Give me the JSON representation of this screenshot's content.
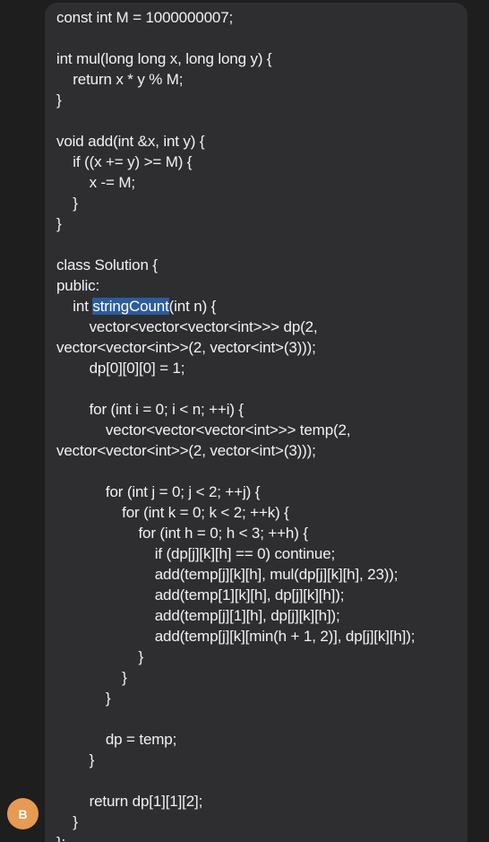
{
  "avatar": {
    "initial": "B",
    "color": "#e69a52"
  },
  "message": {
    "highlighted_word": "stringCount",
    "lines": [
      "const int M = 1000000007;",
      "",
      "int mul(long long x, long long y) {",
      "    return x * y % M;",
      "}",
      "",
      "void add(int &x, int y) {",
      "    if ((x += y) >= M) {",
      "        x -= M;",
      "    }",
      "}",
      "",
      "class Solution {",
      "public:",
      "    int ",
      "        vector<vector<vector<int>>> dp(2,",
      "vector<vector<int>>(2, vector<int>(3)));",
      "        dp[0][0][0] = 1;",
      "",
      "        for (int i = 0; i < n; ++i) {",
      "            vector<vector<vector<int>>> temp(2,",
      "vector<vector<int>>(2, vector<int>(3)));",
      "",
      "            for (int j = 0; j < 2; ++j) {",
      "                for (int k = 0; k < 2; ++k) {",
      "                    for (int h = 0; h < 3; ++h) {",
      "                        if (dp[j][k][h] == 0) continue;",
      "                        add(temp[j][k][h], mul(dp[j][k][h], 23));",
      "                        add(temp[1][k][h], dp[j][k][h]);",
      "                        add(temp[j][1][h], dp[j][k][h]);",
      "                        add(temp[j][k][min(h + 1, 2)], dp[j][k][h]);",
      "                    }",
      "                }",
      "            }",
      "",
      "            dp = temp;",
      "        }",
      "",
      "        return dp[1][1][2];",
      "    }",
      "};"
    ],
    "line_14_suffix": "(int n) {"
  }
}
